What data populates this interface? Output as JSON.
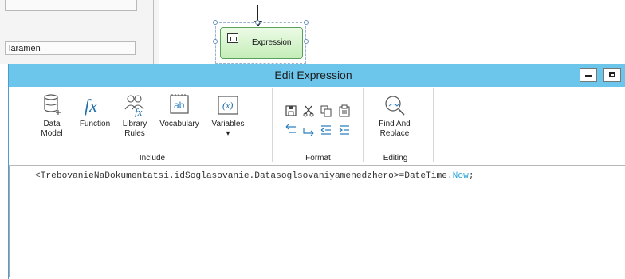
{
  "background": {
    "param_field": "laramen",
    "node_label": "Expression"
  },
  "dialog": {
    "title": "Edit Expression",
    "controls": {
      "minimize": "minimize",
      "maximize": "maximize"
    },
    "ribbon": {
      "include": {
        "label": "Include",
        "buttons": [
          {
            "label1": "Data",
            "label2": "Model",
            "icon": "database-icon"
          },
          {
            "label1": "Function",
            "label2": "",
            "icon": "function-fx-icon"
          },
          {
            "label1": "Library",
            "label2": "Rules",
            "icon": "library-rules-icon"
          },
          {
            "label1": "Vocabulary",
            "label2": "",
            "icon": "vocabulary-ab-icon"
          },
          {
            "label1": "Variables",
            "label2": "▾",
            "icon": "variables-x-icon"
          }
        ]
      },
      "format": {
        "label": "Format",
        "icons": [
          "save-icon",
          "cut-icon",
          "copy-icon",
          "paste-icon",
          "undo-icon",
          "redo-icon",
          "outdent-icon",
          "indent-icon"
        ]
      },
      "editing": {
        "label": "Editing",
        "find_replace_line1": "Find And",
        "find_replace_line2": "Replace",
        "icon": "find-replace-icon"
      }
    },
    "editor": {
      "code_prefix": "<TrebovanieNaDokumentatsi.idSoglasovanie.Datasoglsovaniyamenedzhero>=DateTime.",
      "code_keyword": "Now",
      "code_suffix": ";"
    }
  },
  "colors": {
    "titlebar": "#6cc6ec",
    "node_fill": "#c4edb8",
    "keyword": "#2aa6d9",
    "fx_icon": "#1f6fa8"
  }
}
